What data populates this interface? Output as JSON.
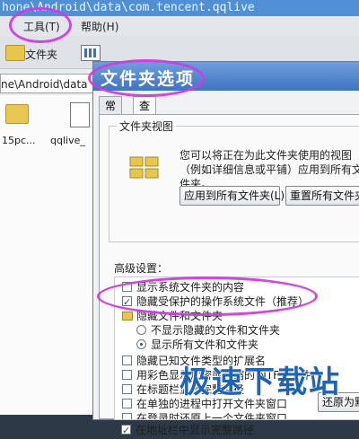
{
  "path_bar": {
    "text": "hone\\Android\\data\\com.tencent.qqlive"
  },
  "menubar": {
    "items": [
      {
        "label": "工具(T)"
      },
      {
        "label": "帮助(H)"
      }
    ]
  },
  "toolbar": {
    "folder_label": "文件夹"
  },
  "address": {
    "text": "ne\\Android\\data"
  },
  "files": {
    "items": [
      {
        "label": "15pc..."
      },
      {
        "label": "qqlive_"
      }
    ]
  },
  "dialog": {
    "title": "文件夹选项",
    "tabs": [
      {
        "label": "常规"
      },
      {
        "label": "查看"
      }
    ],
    "folder_view": {
      "group_label": "文件夹视图",
      "description": "您可以将正在为此文件夹使用的视图（例如详细信息或平铺）应用到所有文件夹。",
      "apply_all_button": "应用到所有文件夹(L)",
      "reset_all_button": "重置所有文件夹(R)"
    },
    "advanced": {
      "label": "高级设置：",
      "options": [
        {
          "label": "显示系统文件夹的内容",
          "type": "checkbox",
          "checked": false
        },
        {
          "label": "隐藏受保护的操作系统文件（推荐）",
          "type": "checkbox",
          "checked": true
        },
        {
          "label": "隐藏文件和文件夹",
          "type": "folder",
          "checked": false
        },
        {
          "label": "不显示隐藏的文件和文件夹",
          "type": "radio",
          "checked": false
        },
        {
          "label": "显示所有文件和文件夹",
          "type": "radio",
          "checked": true
        },
        {
          "label": "隐藏已知文件类型的扩展名",
          "type": "checkbox",
          "checked": false
        },
        {
          "label": "用彩色显示加密或压缩的 NTFS 文件",
          "type": "checkbox",
          "checked": false
        },
        {
          "label": "在标题栏显示完整路径",
          "type": "checkbox",
          "checked": false
        },
        {
          "label": "在单独的进程中打开文件夹窗口",
          "type": "checkbox",
          "checked": false
        },
        {
          "label": "在登录时还原上一个文件夹窗口",
          "type": "checkbox",
          "checked": false
        },
        {
          "label": "在地址栏中显示完整路径",
          "type": "checkbox",
          "checked": true
        }
      ]
    },
    "restore_button": "还原为默认值"
  },
  "watermark": {
    "text": "极速下载站"
  },
  "colors": {
    "marker": "#d23ae0",
    "title_bar": "#3f74c4",
    "watermark": "#1d63b8"
  }
}
